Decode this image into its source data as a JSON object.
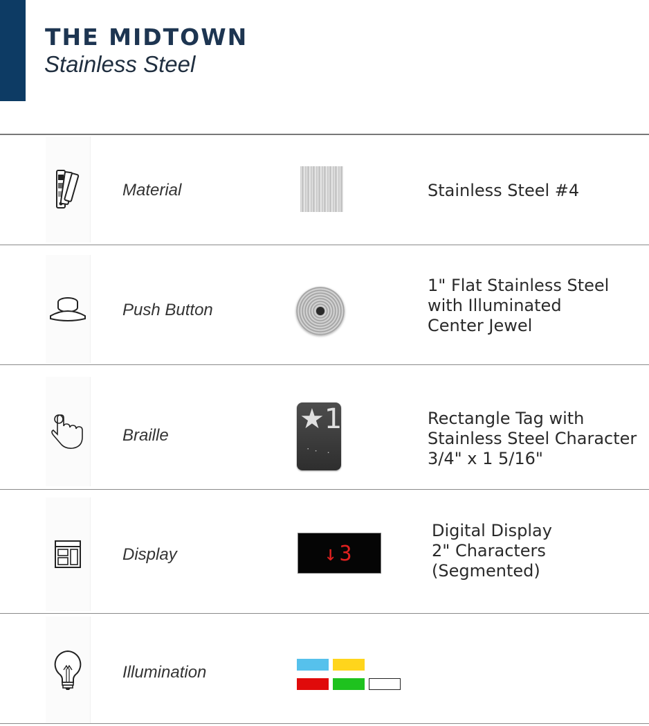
{
  "header": {
    "title": "THE MIDTOWN",
    "subtitle": "Stainless Steel"
  },
  "brand_color": "#0d3b64",
  "rows": [
    {
      "icon": "swatch-fan-icon",
      "label": "Material",
      "description": "Stainless Steel #4"
    },
    {
      "icon": "push-button-icon",
      "label": "Push Button",
      "description": "1\" Flat Stainless Steel\nwith Illuminated\nCenter Jewel"
    },
    {
      "icon": "pointing-hand-icon",
      "label": "Braille",
      "description": "Rectangle Tag with\nStainless Steel Character\n3/4\" x 1 5/16\""
    },
    {
      "icon": "display-layout-icon",
      "label": "Display",
      "description": "Digital Display\n2\" Characters\n(Segmented)"
    },
    {
      "icon": "light-bulb-icon",
      "label": "Illumination",
      "description": ""
    }
  ],
  "braille_tag": {
    "glyph": "★1"
  },
  "display_readout": "↓3",
  "illumination_colors": [
    "#56c1ec",
    "#ffd51c",
    "#e00b0b",
    "#1ec21e",
    "#ffffff"
  ]
}
